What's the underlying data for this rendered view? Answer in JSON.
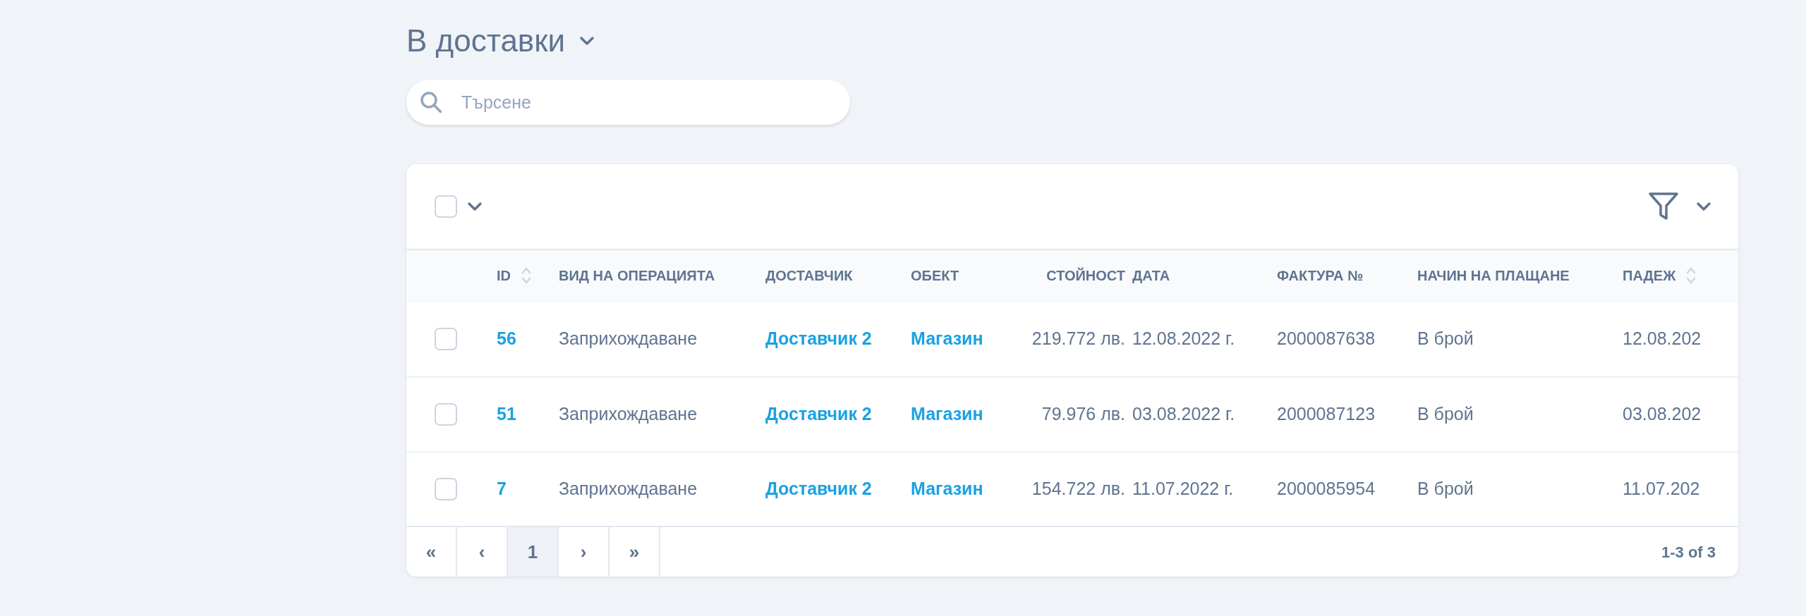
{
  "title": "В доставки",
  "search": {
    "placeholder": "Търсене"
  },
  "toolbar": {
    "select_all_checked": false
  },
  "table": {
    "columns": [
      {
        "label": "ID",
        "kind": "link",
        "sortable": true
      },
      {
        "label": "ВИД НА ОПЕРАЦИЯТА",
        "kind": "text",
        "sortable": false
      },
      {
        "label": "ДОСТАВЧИК",
        "kind": "link",
        "sortable": false
      },
      {
        "label": "ОБЕКТ",
        "kind": "link",
        "sortable": false
      },
      {
        "label": "СТОЙНОСТ",
        "kind": "number",
        "sortable": false
      },
      {
        "label": "ДАТА",
        "kind": "text",
        "sortable": false
      },
      {
        "label": "ФАКТУРА №",
        "kind": "text",
        "sortable": false
      },
      {
        "label": "НАЧИН НА ПЛАЩАНЕ",
        "kind": "text",
        "sortable": false
      },
      {
        "label": "ПАДЕЖ",
        "kind": "text",
        "sortable": true
      }
    ],
    "rows": [
      {
        "checked": false,
        "cells": [
          "56",
          "Заприхождаване",
          "Доставчик 2",
          "Магазин",
          "219.772 лв.",
          "12.08.2022 г.",
          "2000087638",
          "В брой",
          "12.08.202"
        ]
      },
      {
        "checked": false,
        "cells": [
          "51",
          "Заприхождаване",
          "Доставчик 2",
          "Магазин",
          "79.976 лв.",
          "03.08.2022 г.",
          "2000087123",
          "В брой",
          "03.08.202"
        ]
      },
      {
        "checked": false,
        "cells": [
          "7",
          "Заприхождаване",
          "Доставчик 2",
          "Магазин",
          "154.722 лв.",
          "11.07.2022 г.",
          "2000085954",
          "В брой",
          "11.07.202"
        ]
      }
    ]
  },
  "pagination": {
    "buttons": [
      {
        "label": "«",
        "selected": false
      },
      {
        "label": "‹",
        "selected": false
      },
      {
        "label": "1",
        "selected": true
      },
      {
        "label": "›",
        "selected": false
      },
      {
        "label": "»",
        "selected": false
      }
    ],
    "range": "1-3 of 3"
  }
}
